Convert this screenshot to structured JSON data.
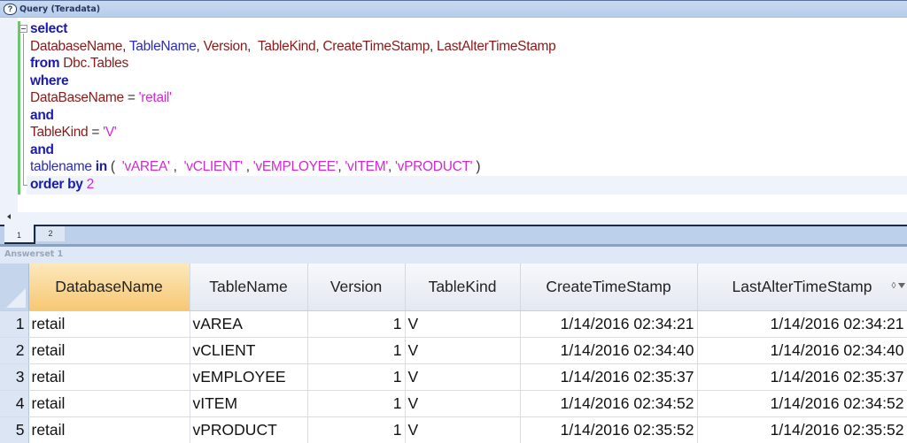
{
  "window": {
    "title": "Query (Teradata)",
    "icon": "query-help-icon"
  },
  "editor": {
    "lines": [
      [
        {
          "t": "select",
          "c": "kw"
        }
      ],
      [
        {
          "t": "DatabaseName",
          "c": "id"
        },
        {
          "t": ", ",
          "c": "op"
        },
        {
          "t": "TableName",
          "c": "id2"
        },
        {
          "t": ", ",
          "c": "op"
        },
        {
          "t": "Version",
          "c": "id"
        },
        {
          "t": ",  ",
          "c": "op"
        },
        {
          "t": "TableKind",
          "c": "id"
        },
        {
          "t": ", ",
          "c": "op"
        },
        {
          "t": "CreateTimeStamp",
          "c": "id"
        },
        {
          "t": ", ",
          "c": "op"
        },
        {
          "t": "LastAlterTimeStamp",
          "c": "id"
        }
      ],
      [
        {
          "t": "from ",
          "c": "kw"
        },
        {
          "t": "Dbc.Tables",
          "c": "id"
        }
      ],
      [
        {
          "t": "where",
          "c": "kw"
        }
      ],
      [
        {
          "t": "DataBaseName",
          "c": "id"
        },
        {
          "t": " = ",
          "c": "op"
        },
        {
          "t": "'retail'",
          "c": "str"
        }
      ],
      [
        {
          "t": "and",
          "c": "kw"
        }
      ],
      [
        {
          "t": "TableKind",
          "c": "id"
        },
        {
          "t": " = ",
          "c": "op"
        },
        {
          "t": "'V'",
          "c": "str"
        }
      ],
      [
        {
          "t": "and",
          "c": "kw"
        }
      ],
      [
        {
          "t": "tablename ",
          "c": "id2"
        },
        {
          "t": "in",
          "c": "kw"
        },
        {
          "t": " (  ",
          "c": "op"
        },
        {
          "t": "'vAREA'",
          "c": "str"
        },
        {
          "t": " ,  ",
          "c": "op"
        },
        {
          "t": "'vCLIENT'",
          "c": "str"
        },
        {
          "t": " , ",
          "c": "op"
        },
        {
          "t": "'vEMPLOYEE'",
          "c": "str"
        },
        {
          "t": ", ",
          "c": "op"
        },
        {
          "t": "'vITEM'",
          "c": "str"
        },
        {
          "t": ", ",
          "c": "op"
        },
        {
          "t": "'vPRODUCT'",
          "c": "str"
        },
        {
          "t": " )",
          "c": "op"
        }
      ],
      [
        {
          "t": "order by ",
          "c": "kw"
        },
        {
          "t": "2",
          "c": "num"
        }
      ]
    ]
  },
  "tabs": [
    {
      "label": "1",
      "active": true
    },
    {
      "label": "2",
      "active": false
    }
  ],
  "answerset": {
    "label": "Answerset 1",
    "columns": [
      "DatabaseName",
      "TableName",
      "Version",
      "TableKind",
      "CreateTimeStamp",
      "LastAlterTimeStamp"
    ],
    "sorted_column": "DatabaseName",
    "rows": [
      {
        "n": "1",
        "cells": [
          "retail",
          "vAREA",
          "1",
          "V",
          "1/14/2016 02:34:21",
          "1/14/2016 02:34:21"
        ]
      },
      {
        "n": "2",
        "cells": [
          "retail",
          "vCLIENT",
          "1",
          "V",
          "1/14/2016 02:34:40",
          "1/14/2016 02:34:40"
        ]
      },
      {
        "n": "3",
        "cells": [
          "retail",
          "vEMPLOYEE",
          "1",
          "V",
          "1/14/2016 02:35:37",
          "1/14/2016 02:35:37"
        ]
      },
      {
        "n": "4",
        "cells": [
          "retail",
          "vITEM",
          "1",
          "V",
          "1/14/2016 02:34:52",
          "1/14/2016 02:34:52"
        ]
      },
      {
        "n": "5",
        "cells": [
          "retail",
          "vPRODUCT",
          "1",
          "V",
          "1/14/2016 02:35:52",
          "1/14/2016 02:35:52"
        ]
      }
    ],
    "header_icons": {
      "sort": "sort-diamond-icon",
      "filter": "filter-funnel-icon",
      "sort_glyph": "◊"
    }
  },
  "colors": {
    "keyword": "#1b1bab",
    "identifier": "#8b1a1a",
    "string": "#d12ad1",
    "sorted_header": "#f6c873",
    "change_bar": "#6cc66c"
  }
}
